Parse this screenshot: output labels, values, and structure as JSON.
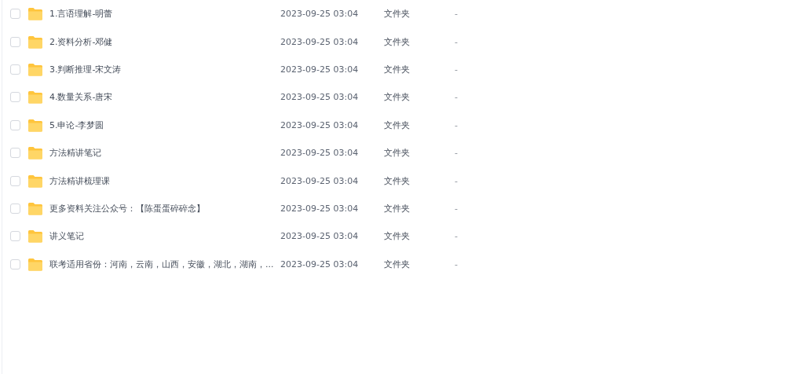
{
  "files": [
    {
      "name": "1.言语理解-明蕾",
      "modified": "2023-09-25 03:04",
      "type": "文件夹",
      "size": "-",
      "checked": false
    },
    {
      "name": "2.资料分析-邓健",
      "modified": "2023-09-25 03:04",
      "type": "文件夹",
      "size": "-",
      "checked": false
    },
    {
      "name": "3.判断推理-宋文涛",
      "modified": "2023-09-25 03:04",
      "type": "文件夹",
      "size": "-",
      "checked": false
    },
    {
      "name": "4.数量关系-唐宋",
      "modified": "2023-09-25 03:04",
      "type": "文件夹",
      "size": "-",
      "checked": false
    },
    {
      "name": "5.申论-李梦圆",
      "modified": "2023-09-25 03:04",
      "type": "文件夹",
      "size": "-",
      "checked": false
    },
    {
      "name": "方法精讲笔记",
      "modified": "2023-09-25 03:04",
      "type": "文件夹",
      "size": "-",
      "checked": false
    },
    {
      "name": "方法精讲梳理课",
      "modified": "2023-09-25 03:04",
      "type": "文件夹",
      "size": "-",
      "checked": false
    },
    {
      "name": "更多资料关注公众号：【陈蛋蛋碎碎念】",
      "modified": "2023-09-25 03:04",
      "type": "文件夹",
      "size": "-",
      "checked": false
    },
    {
      "name": "讲义笔记",
      "modified": "2023-09-25 03:04",
      "type": "文件夹",
      "size": "-",
      "checked": false
    },
    {
      "name": "联考适用省份：河南，云南，山西，安徽，湖北，湖南，...",
      "modified": "2023-09-25 03:04",
      "type": "文件夹",
      "size": "-",
      "checked": false
    }
  ]
}
